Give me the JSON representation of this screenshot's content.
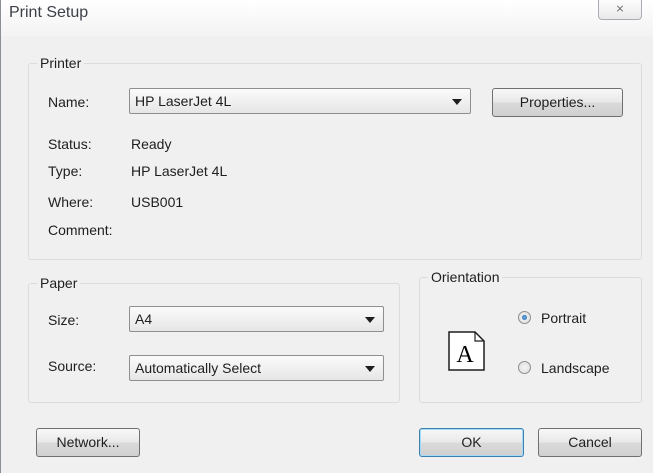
{
  "window": {
    "title": "Print Setup",
    "close_glyph": "⌨",
    "close_icon": "close-icon"
  },
  "printer": {
    "legend": "Printer",
    "name_label": "Name:",
    "name_value": "HP LaserJet 4L",
    "properties_button": "Properties...",
    "status_label": "Status:",
    "status_value": "Ready",
    "type_label": "Type:",
    "type_value": "HP LaserJet 4L",
    "where_label": "Where:",
    "where_value": "USB001",
    "comment_label": "Comment:",
    "comment_value": ""
  },
  "paper": {
    "legend": "Paper",
    "size_label": "Size:",
    "size_value": "A4",
    "source_label": "Source:",
    "source_value": "Automatically Select"
  },
  "orientation": {
    "legend": "Orientation",
    "page_glyph": "A",
    "portrait_label": "Portrait",
    "portrait_selected": true,
    "landscape_label": "Landscape",
    "landscape_selected": false
  },
  "buttons": {
    "network": "Network...",
    "ok": "OK",
    "cancel": "Cancel"
  }
}
